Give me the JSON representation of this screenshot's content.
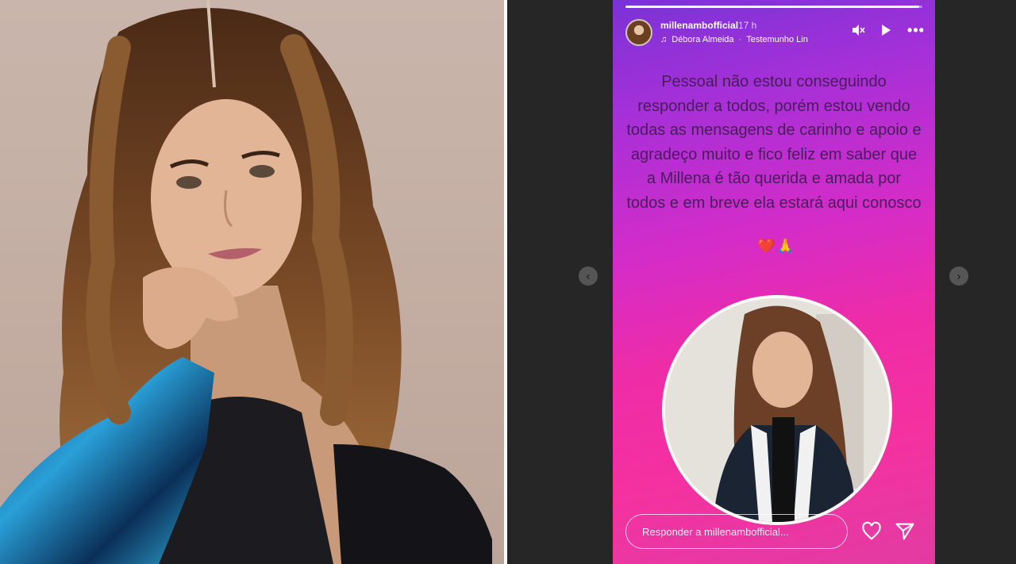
{
  "story": {
    "username": "millenambofficial",
    "time": "17 h",
    "music_icon": "music-note-icon",
    "music_artist": "Débora Almeida",
    "music_title": "Testemunho Lin",
    "message": "Pessoal não estou conseguindo responder a todos, porém estou vendo todas as mensagens de carinho e apoio e agradeço muito e fico feliz em saber que a Millena é tão querida e amada por todos e em breve ela estará aqui conosco",
    "emoji": "❤️🙏",
    "reply_placeholder": "Responder a millenambofficial...",
    "progress": 0.99,
    "colors": {
      "gradient_top": "#7a33d6",
      "gradient_mid": "#d52cc8",
      "gradient_bottom": "#f531a0",
      "text": "#4a1c5c"
    }
  },
  "controls": {
    "mute_icon": "mute-icon",
    "play_icon": "play-icon",
    "more_icon": "more-options-icon",
    "like_icon": "heart-icon",
    "share_icon": "send-icon",
    "prev_icon": "chevron-left-icon",
    "next_icon": "chevron-right-icon"
  },
  "viewer": {
    "background": "#262626"
  }
}
